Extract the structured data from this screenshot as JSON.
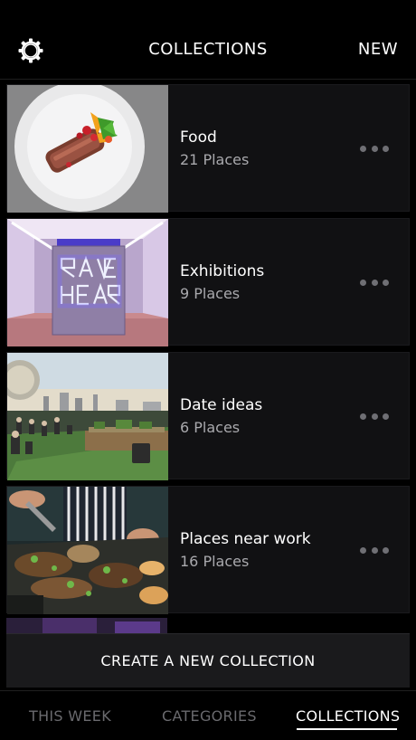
{
  "header": {
    "title": "COLLECTIONS",
    "new_label": "NEW",
    "settings_icon": "gear-icon"
  },
  "collections": [
    {
      "title": "Food",
      "subtitle": "21 Places",
      "image": "food-plate-image",
      "more_icon": "more-dots-icon"
    },
    {
      "title": "Exhibitions",
      "subtitle": "9 Places",
      "image": "neon-exhibition-image",
      "more_icon": "more-dots-icon"
    },
    {
      "title": "Date ideas",
      "subtitle": "6 Places",
      "image": "rooftop-terrace-image",
      "more_icon": "more-dots-icon"
    },
    {
      "title": "Places near work",
      "subtitle": "16 Places",
      "image": "street-food-image",
      "more_icon": "more-dots-icon"
    }
  ],
  "create_button": {
    "label": "CREATE A NEW COLLECTION"
  },
  "tabs": [
    {
      "label": "THIS WEEK",
      "active": false
    },
    {
      "label": "CATEGORIES",
      "active": false
    },
    {
      "label": "COLLECTIONS",
      "active": true
    }
  ],
  "colors": {
    "background": "#000000",
    "card": "#111113",
    "subtitle": "#a9a9ad",
    "inactive_tab": "#6a6a6e"
  }
}
